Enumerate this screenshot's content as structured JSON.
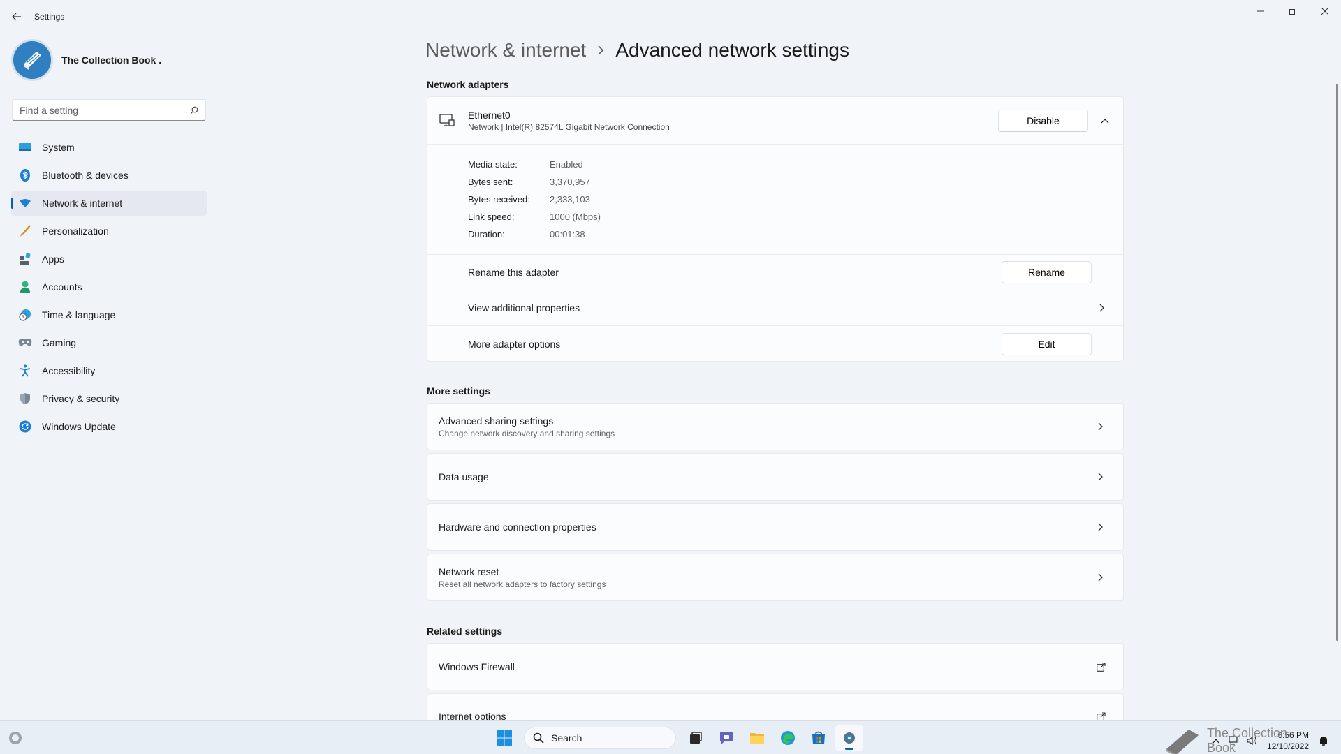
{
  "window": {
    "app_title": "Settings"
  },
  "profile": {
    "name": "The Collection Book ."
  },
  "search": {
    "placeholder": "Find a setting"
  },
  "sidebar": {
    "items": [
      {
        "label": "System",
        "icon": "system-icon"
      },
      {
        "label": "Bluetooth & devices",
        "icon": "bluetooth-icon"
      },
      {
        "label": "Network & internet",
        "icon": "wifi-icon",
        "active": true
      },
      {
        "label": "Personalization",
        "icon": "brush-icon"
      },
      {
        "label": "Apps",
        "icon": "apps-icon"
      },
      {
        "label": "Accounts",
        "icon": "person-icon"
      },
      {
        "label": "Time & language",
        "icon": "clock-globe-icon"
      },
      {
        "label": "Gaming",
        "icon": "gamepad-icon"
      },
      {
        "label": "Accessibility",
        "icon": "accessibility-icon"
      },
      {
        "label": "Privacy & security",
        "icon": "shield-icon"
      },
      {
        "label": "Windows Update",
        "icon": "update-icon"
      }
    ]
  },
  "header": {
    "parent": "Network & internet",
    "current": "Advanced network settings"
  },
  "adapters": {
    "section_title": "Network adapters",
    "name": "Ethernet0",
    "description": "Network | Intel(R) 82574L Gigabit Network Connection",
    "disable_label": "Disable",
    "properties": [
      {
        "label": "Media state:",
        "value": "Enabled"
      },
      {
        "label": "Bytes sent:",
        "value": "3,370,957"
      },
      {
        "label": "Bytes received:",
        "value": "2,333,103"
      },
      {
        "label": "Link speed:",
        "value": "1000 (Mbps)"
      },
      {
        "label": "Duration:",
        "value": "00:01:38"
      }
    ],
    "rename_label": "Rename this adapter",
    "rename_button": "Rename",
    "view_props_label": "View additional properties",
    "more_options_label": "More adapter options",
    "edit_button": "Edit"
  },
  "more_settings": {
    "section_title": "More settings",
    "items": [
      {
        "title": "Advanced sharing settings",
        "subtitle": "Change network discovery and sharing settings"
      },
      {
        "title": "Data usage",
        "subtitle": ""
      },
      {
        "title": "Hardware and connection properties",
        "subtitle": ""
      },
      {
        "title": "Network reset",
        "subtitle": "Reset all network adapters to factory settings"
      }
    ]
  },
  "related_settings": {
    "section_title": "Related settings",
    "items": [
      {
        "title": "Windows Firewall"
      },
      {
        "title": "Internet options"
      }
    ]
  },
  "taskbar": {
    "search_label": "Search",
    "time": "6:56 PM",
    "date": "12/10/2022",
    "watermark": "The Collection Book"
  },
  "colors": {
    "accent": "#005fb8",
    "background": "#f0f4f9"
  }
}
